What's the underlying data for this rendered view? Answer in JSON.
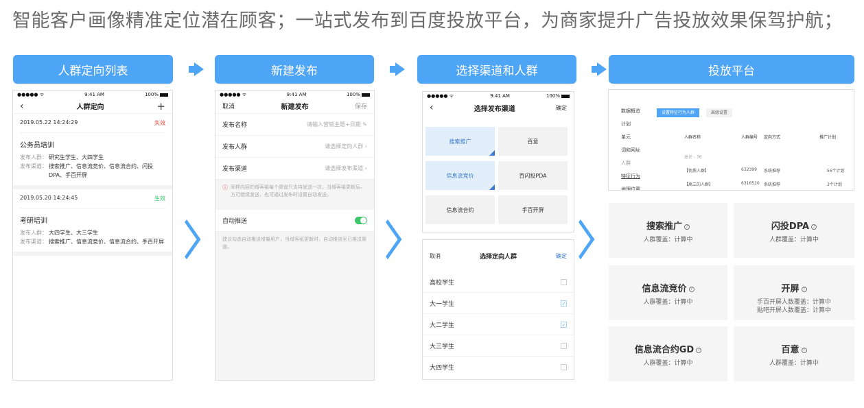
{
  "headline": "智能客户画像精准定位潜在顾客；一站式发布到百度投放平台，为商家提升广告投放效果保驾护航；",
  "steps": [
    "人群定向列表",
    "新建发布",
    "选择渠道和人群",
    "投放平台"
  ],
  "colors": {
    "accent": "#4fa5f5",
    "invalid": "#e8453c",
    "valid": "#3dc66b"
  },
  "status_bar": {
    "signal": "●●●●● ᯤ",
    "time": "9:41 AM",
    "battery": "100%"
  },
  "phone1": {
    "back_icon": "chevron-left-icon",
    "title": "人群定向",
    "add_icon": "plus-icon",
    "cards": [
      {
        "date": "2019.05.22 14:24:29",
        "status": "失效",
        "name": "公务员培训",
        "k1": "发布人群：",
        "v1": "研究生学生、大四学生",
        "k2": "发布渠道：",
        "v2": "搜索推广、信息流竞价、信息流合约、闪投DPA、手百开屏"
      },
      {
        "date": "2019.05.20 14:24:45",
        "status": "生效",
        "name": "考研培训",
        "k1": "发布人群：",
        "v1": "大四学生、大三学生",
        "k2": "发布渠道：",
        "v2": "搜索推广、信息流竞价、信息流合约、手百开屏"
      }
    ]
  },
  "phone2": {
    "cancel": "取消",
    "title": "新建发布",
    "save": "保存",
    "rows": [
      {
        "label": "发布名称",
        "placeholder": "请输入营销主题+日期"
      },
      {
        "label": "发布人群",
        "placeholder": "请选择定向人群"
      },
      {
        "label": "发布渠道",
        "placeholder": "请选择发布渠道"
      }
    ],
    "warning": "同样内容的增客组每个渠道只支持发送一次，当增客组更新后，方可继续发送，也可通过发布时设置自动发送。",
    "auto_label": "自动推送",
    "auto_note": "建议勾选自动推送增量用户，当增客组更新时，自动推送至已推送渠道。"
  },
  "phone3": {
    "top": {
      "back_icon": "chevron-left-icon",
      "title": "选择发布渠道",
      "confirm": "确定",
      "tiles": [
        "搜索推广",
        "百意",
        "信息流竞价",
        "百闪投PDA",
        "信息流合约",
        "手百开屏"
      ]
    },
    "bottom": {
      "cancel": "取消",
      "title": "选择定向人群",
      "confirm": "确定",
      "items": [
        {
          "label": "高校学生",
          "checked": false
        },
        {
          "label": "大一学生",
          "checked": true
        },
        {
          "label": "大二学生",
          "checked": true
        },
        {
          "label": "大三学生",
          "checked": false
        },
        {
          "label": "大四学生",
          "checked": false
        }
      ]
    }
  },
  "dashboard": {
    "sidebar": [
      "数据概览",
      "计划",
      "单元",
      "词和网址",
      "人群",
      "特征行为",
      "地理位置"
    ],
    "btn_primary": "设置特征行为人群",
    "btn_secondary": "高级设置",
    "headers": [
      "人群名称",
      "人群编号",
      "定向方式",
      "推广计划"
    ],
    "total_label": "总计 - 76",
    "rows": [
      {
        "name": "【优质人群】",
        "id": "632399",
        "mode": "系统推荐",
        "plans": "56个计划"
      },
      {
        "name": "【高三的人群】",
        "id": "6316520",
        "mode": "系统推荐",
        "plans": "3个计划"
      }
    ]
  },
  "platforms": [
    {
      "title": "搜索推广",
      "lines": [
        "人群覆盖：计算中"
      ]
    },
    {
      "title": "闪投DPA",
      "lines": [
        "人群覆盖：计算中"
      ]
    },
    {
      "title": "信息流竞价",
      "lines": [
        "人群覆盖：计算中"
      ]
    },
    {
      "title": "开屏",
      "lines": [
        "手百开屏人数覆盖：计算中",
        "贴吧开屏人数覆盖：计算中"
      ]
    },
    {
      "title": "信息流合约GD",
      "lines": [
        "人群覆盖：计算中"
      ]
    },
    {
      "title": "百意",
      "lines": [
        "人群覆盖：计算中"
      ]
    }
  ]
}
